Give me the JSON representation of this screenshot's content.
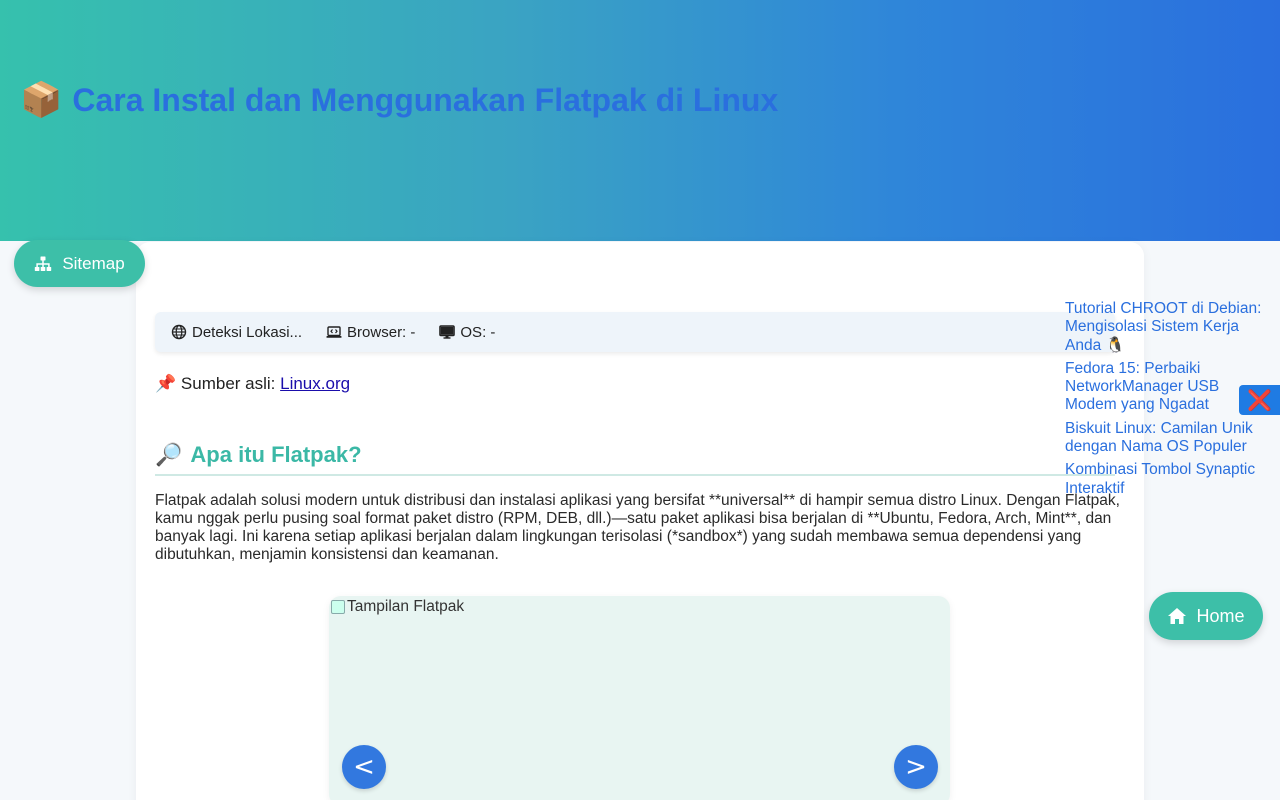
{
  "header": {
    "title_icon": "📦",
    "title": "Cara Instal dan Menggunakan Flatpak di Linux"
  },
  "info_bar": {
    "location": "Deteksi Lokasi...",
    "browser": "Browser: -",
    "os": "OS: -"
  },
  "source": {
    "icon": "📌",
    "prefix": "Sumber asli:",
    "link_text": "Linux.org"
  },
  "section": {
    "icon": "🔎",
    "title": "Apa itu Flatpak?",
    "paragraph": "Flatpak adalah solusi modern untuk distribusi dan instalasi aplikasi yang bersifat **universal** di hampir semua distro Linux. Dengan Flatpak, kamu nggak perlu pusing soal format paket distro (RPM, DEB, dll.)—satu paket aplikasi bisa berjalan di **Ubuntu, Fedora, Arch, Mint**, dan banyak lagi. Ini karena setiap aplikasi berjalan dalam lingkungan terisolasi (*sandbox*) yang sudah membawa semua dependensi yang dibutuhkan, menjamin konsistensi dan keamanan."
  },
  "slider": {
    "image_alt": "Tampilan Flatpak",
    "prev_label": "<",
    "next_label": ">"
  },
  "sitemap_button": {
    "label": "Sitemap",
    "icon": "sitemap-icon"
  },
  "related_links": [
    {
      "label": "Tutorial CHROOT di Debian: Mengisolasi Sistem Kerja Anda 🐧"
    },
    {
      "label": "Fedora 15: Perbaiki NetworkManager USB Modem yang Ngadat"
    },
    {
      "label": "Biskuit Linux: Camilan Unik dengan Nama OS Populer"
    },
    {
      "label": "Kombinasi Tombol Synaptic Interaktif"
    }
  ],
  "close_button": {
    "label": "❌"
  },
  "home_button": {
    "label": "Home",
    "icon": "home-icon"
  },
  "colors": {
    "accent_teal": "#3dbfa8",
    "accent_blue": "#2a6fde",
    "gradient_start": "#36c1ad",
    "gradient_end": "#2a6fde"
  }
}
